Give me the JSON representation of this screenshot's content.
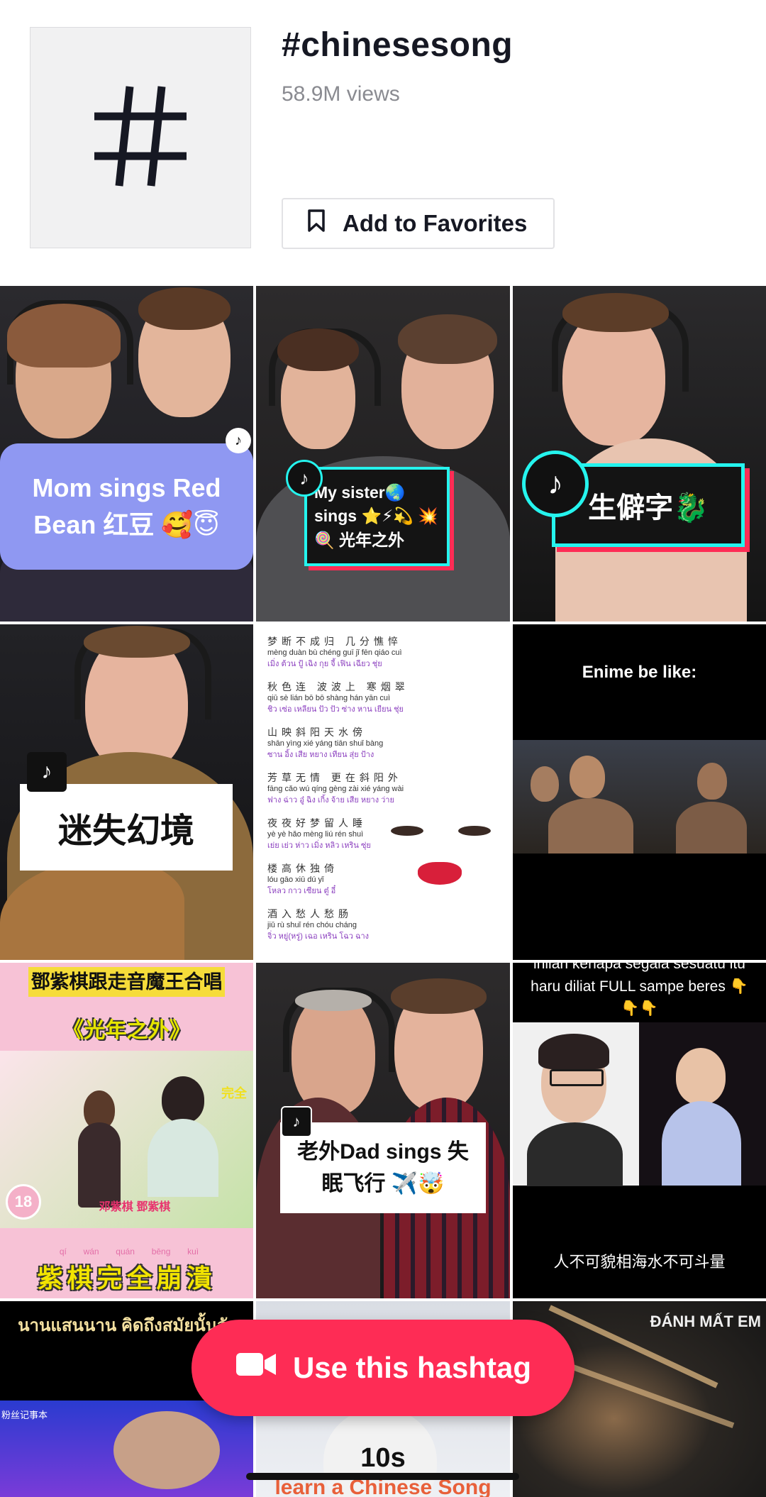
{
  "hashtag": {
    "title": "#chinesesong",
    "views": "58.9M views",
    "favorite_label": "Add to Favorites",
    "icon": "hashtag-icon"
  },
  "videos": [
    {
      "caption": "Mom sings Red Bean 红豆 🥰😇"
    },
    {
      "caption": "My sister🌏 sings ⭐⚡💫 💥🍭 光年之外"
    },
    {
      "caption": "生僻字🐉"
    },
    {
      "caption": "迷失幻境"
    },
    {
      "lyrics": [
        {
          "hanzi": "梦断不成归 几分憔悴",
          "pinyin": "mèng duàn bù chéng guī  jǐ fēn qiáo cuì",
          "thai": "เมิ่ง ต้วน ปู้ เฉิง กุย จี้ เฟิน เฉียว ชุ่ย"
        },
        {
          "hanzi": "秋色连 波波上 寒烟翠",
          "pinyin": "qiū sè lián bō bō shàng hán yān cuì",
          "thai": "ชิว เซ่อ เหลียน ปัว ปัว ซ่าง หาน เยียน ชุ่ย"
        },
        {
          "hanzi": "山映斜阳天水傍",
          "pinyin": "shān yìng xié yáng tiān shuǐ bàng",
          "thai": "ซาน อิ้ง เสีย หยาง เทียน สุ่ย ป้าง"
        },
        {
          "hanzi": "芳草无情 更在斜阳外",
          "pinyin": "fāng cǎo wú qíng  gèng zài xié yáng wài",
          "thai": "ฟาง ฉ่าว อู๋ ฉิง เกิ้ง จ้าย เสีย หยาง ว่าย"
        },
        {
          "hanzi": "夜夜好梦留人睡",
          "pinyin": "yè yè hǎo mèng liú rén shuì",
          "thai": "เย่ย เย่ว ห่าว เมิ่ง หลิว เหริน ซุ่ย"
        },
        {
          "hanzi": "楼高休独倚",
          "pinyin": "lóu gāo xiū dú yǐ",
          "thai": "โหลว กาว เซียน ตู๋ อี๋"
        },
        {
          "hanzi": "酒入愁人愁肠",
          "pinyin": "jiǔ rù shuǐ rén chóu cháng",
          "thai": "จิ่ว หยู่(หรู่) เฉอ เหริน โฉว ฉาง"
        }
      ]
    },
    {
      "caption": "Enime be like:"
    },
    {
      "caption_top": "鄧紫棋跟走音魔王合唱",
      "caption_mid": "《光年之外》",
      "caption_bottom": "紫棋完全崩潰",
      "ruby": [
        "qí",
        "wán",
        "quán",
        "bēng",
        "kuì"
      ],
      "badge": "18",
      "side_label": "完全",
      "pink_label": "邓紫棋 鄧紫棋"
    },
    {
      "caption": "老外Dad sings 失眠飞行 ✈️🤯"
    },
    {
      "caption_top": "inilah kenapa segala sesuatu itu haru diliat FULL sampe beres 👇👇👇",
      "caption_bottom": "人不可貌相海水不可斗量"
    },
    {
      "caption": "นานแสนนาน คิดถึงสมัยนั้นจัง",
      "small": "粉丝记事本"
    },
    {
      "caption": "10s",
      "bottom": "learn a Chinese Song"
    },
    {
      "caption": "ĐÁNH MẤT EM"
    }
  ],
  "use_button": {
    "label": "Use this hashtag",
    "icon": "video-camera-icon"
  },
  "colors": {
    "accent": "#fe2c55",
    "tiktok_cyan": "#25f4ee",
    "tiktok_red": "#fe2c55"
  }
}
